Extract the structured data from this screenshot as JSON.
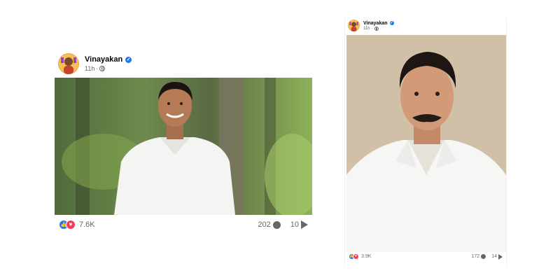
{
  "posts": [
    {
      "author": "Vinayakan",
      "time": "11h",
      "separator": "·",
      "reactions": "7.6K",
      "comments": "202",
      "shares": "10",
      "icons": [
        "verified-badge",
        "globe",
        "like",
        "love",
        "comment",
        "share"
      ],
      "photo_subject": "smiling man with glasses in white kurta against green foliage"
    },
    {
      "author": "Vinayakan",
      "time": "11h",
      "separator": "·",
      "reactions": "3.9K",
      "comments": "172",
      "shares": "14",
      "icons": [
        "verified-badge",
        "globe",
        "like",
        "love",
        "comment",
        "share"
      ],
      "photo_subject": "man with moustache in white shirt against beige background"
    }
  ],
  "colors": {
    "facebook_blue": "#1877f2",
    "love_red": "#f33e58",
    "meta_gray": "#65676b"
  }
}
